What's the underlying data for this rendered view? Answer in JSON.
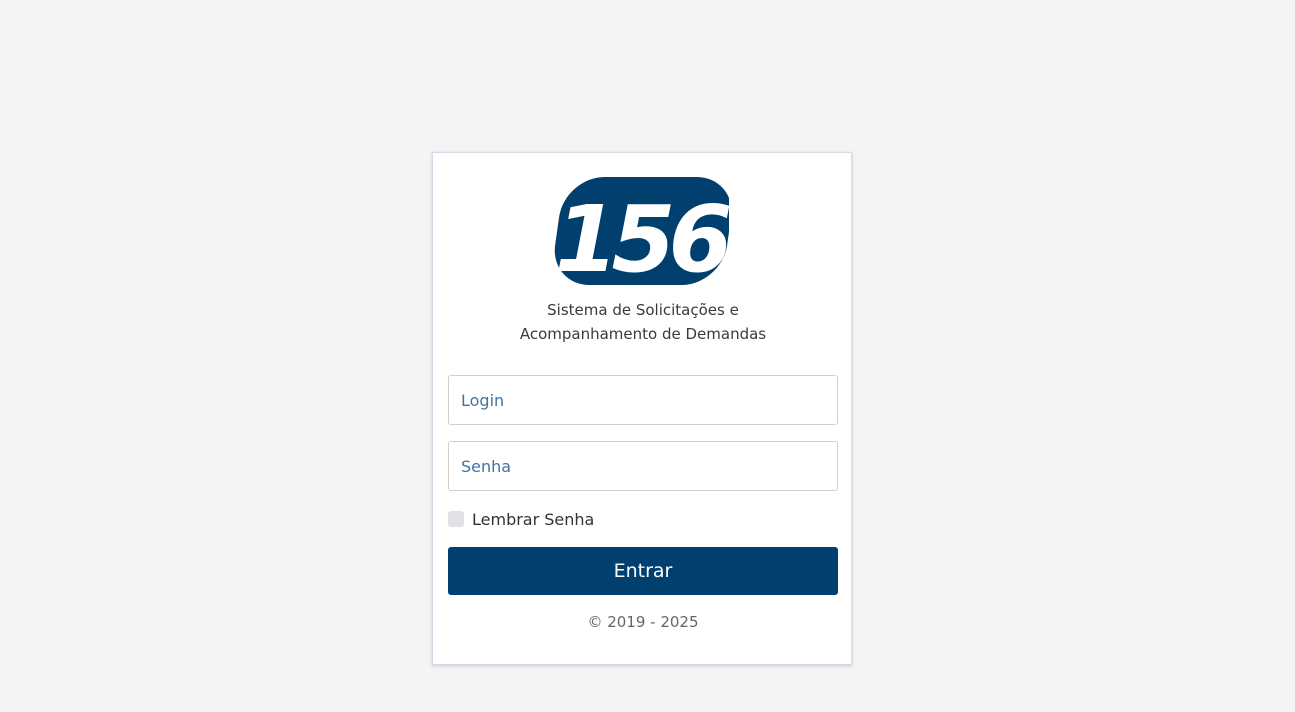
{
  "logo": {
    "text": "156",
    "brand_color": "#003f6e"
  },
  "subtitle": {
    "line1": "Sistema de Solicitações e",
    "line2": "Acompanhamento de Demandas"
  },
  "form": {
    "login_placeholder": "Login",
    "password_placeholder": "Senha",
    "remember_label": "Lembrar Senha",
    "remember_checked": false,
    "submit_label": "Entrar"
  },
  "footer": {
    "copyright": "© 2019 - 2025"
  },
  "colors": {
    "background": "#f4f4f4",
    "button": "#003f6e",
    "placeholder": "#3f74a6"
  }
}
